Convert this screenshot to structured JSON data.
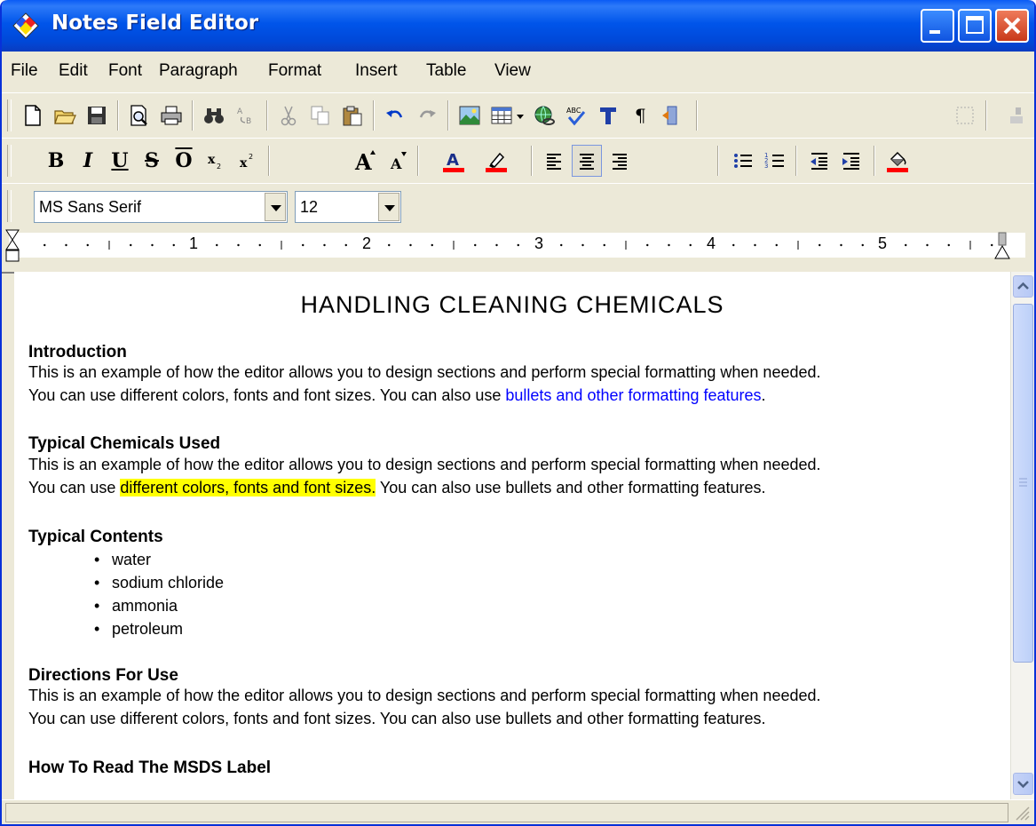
{
  "window": {
    "title": "Notes Field Editor"
  },
  "menu": [
    "File",
    "Edit",
    "Font",
    "Paragraph",
    "Format",
    "Insert",
    "Table",
    "View"
  ],
  "format_toolbar": {
    "bold": "B",
    "italic": "I",
    "underline": "U",
    "strike": "S",
    "overline": "O"
  },
  "font_toolbar": {
    "font_name": "MS Sans Serif",
    "font_size": "12"
  },
  "ruler": {
    "numbers": [
      "1",
      "2",
      "3",
      "4",
      "5"
    ]
  },
  "document": {
    "title": "HANDLING CLEANING CHEMICALS",
    "sections": [
      {
        "heading": "Introduction",
        "line1": "This is an example of how the editor allows you to design sections and perform special formatting when needed.",
        "line2_pre": "You can use different colors, fonts and font sizes.  You can also use ",
        "line2_link": "bullets and other formatting features",
        "line2_post": "."
      },
      {
        "heading": "Typical Chemicals Used",
        "line1": "This is an example of how the editor allows you to design sections and perform special formatting when needed.",
        "line2_pre": "You can use ",
        "line2_highlight": "different colors, fonts and font sizes.",
        "line2_post": "  You can also use bullets and other formatting features."
      },
      {
        "heading": "Typical Contents",
        "bullets": [
          "water",
          "sodium chloride",
          "ammonia",
          "petroleum"
        ]
      },
      {
        "heading": "Directions For Use",
        "line1": "This is an example of how the editor allows you to design sections and perform special formatting when needed.",
        "line2": "You can use different colors, fonts and font sizes.  You can also use bullets and other formatting features."
      },
      {
        "heading": "How To Read The MSDS Label"
      }
    ]
  },
  "colors": {
    "titlebar": "#0055ea",
    "link": "#0000ff",
    "highlight": "#ffff00",
    "font_color_bar": "#ff0000"
  }
}
